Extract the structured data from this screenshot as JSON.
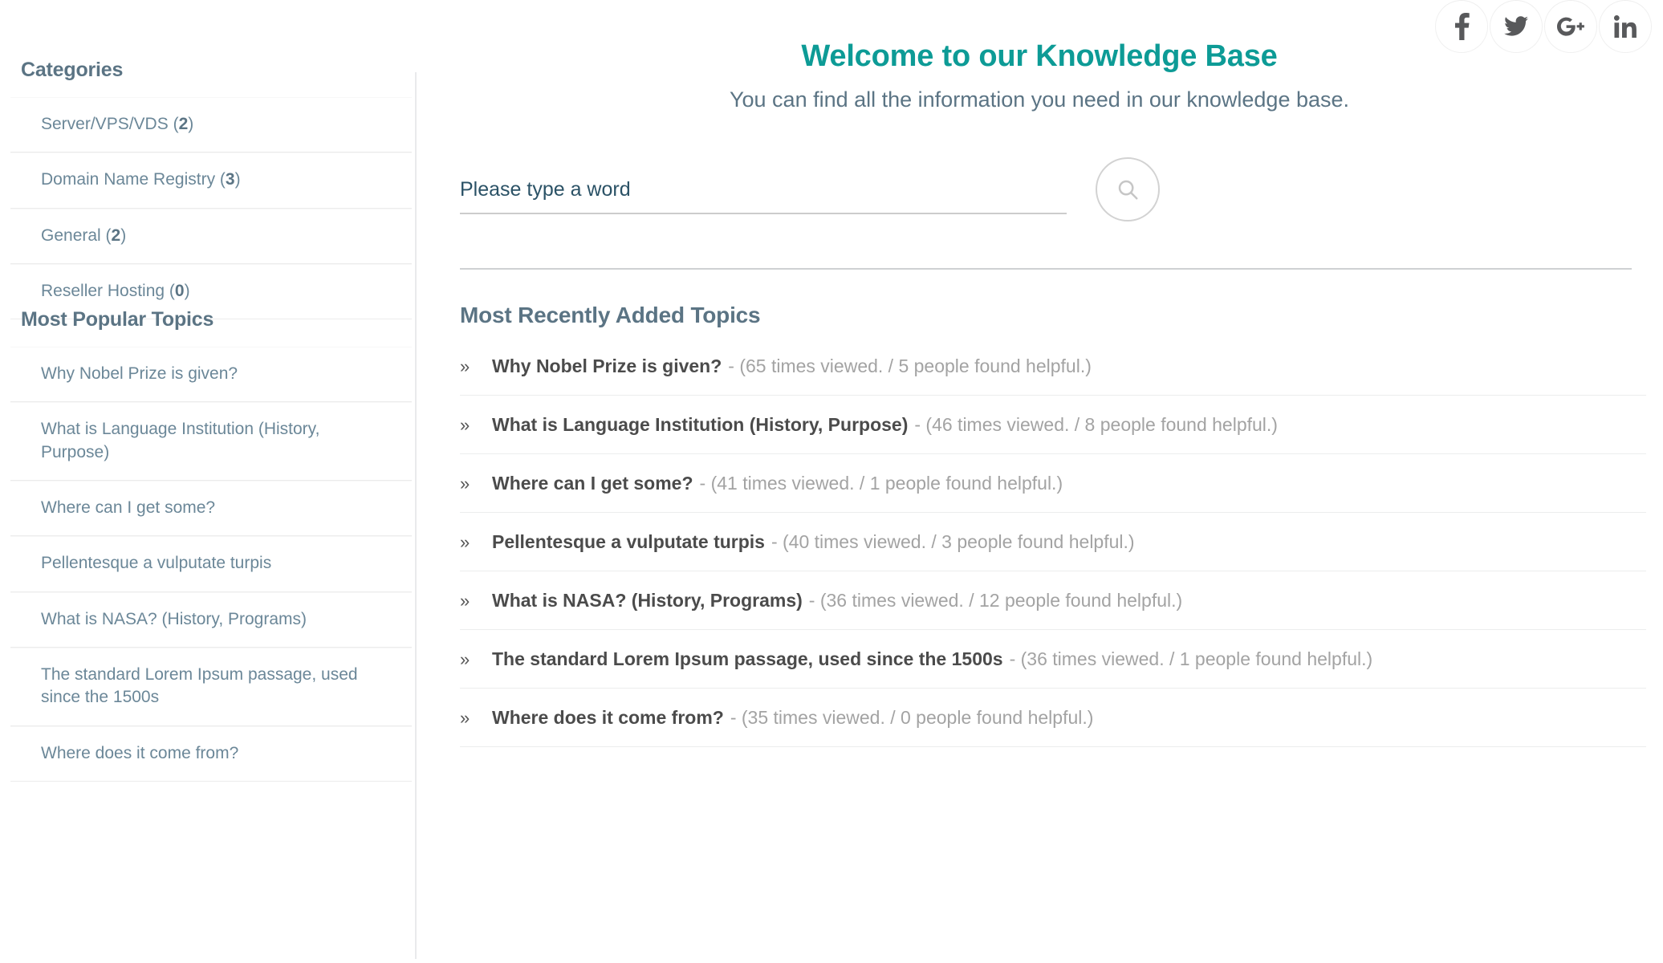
{
  "social": {
    "items": [
      {
        "name": "facebook",
        "label": "f"
      },
      {
        "name": "twitter",
        "label": "t"
      },
      {
        "name": "google-plus",
        "label": "G+"
      },
      {
        "name": "linkedin",
        "label": "in"
      }
    ]
  },
  "sidebar": {
    "categories": {
      "title": "Categories",
      "items": [
        {
          "label": "Server/VPS/VDS",
          "count": "2"
        },
        {
          "label": "Domain Name Registry",
          "count": "3"
        },
        {
          "label": "General",
          "count": "2"
        },
        {
          "label": "Reseller Hosting",
          "count": "0"
        }
      ]
    },
    "popular": {
      "title": "Most Popular Topics",
      "items": [
        {
          "label": "Why Nobel Prize is given?"
        },
        {
          "label": "What is Language Institution (History, Purpose)"
        },
        {
          "label": "Where can I get some?"
        },
        {
          "label": "Pellentesque a vulputate turpis"
        },
        {
          "label": "What is NASA? (History, Programs)"
        },
        {
          "label": "The standard Lorem Ipsum passage, used since the 1500s"
        },
        {
          "label": "Where does it come from?"
        }
      ]
    }
  },
  "hero": {
    "title": "Welcome to our Knowledge Base",
    "subtitle": "You can find all the information you need in our knowledge base."
  },
  "search": {
    "value": "",
    "placeholder": "Please type a word",
    "icon": "search-icon"
  },
  "main": {
    "section_title": "Most Recently Added Topics",
    "chevron": "»",
    "topics": [
      {
        "title": "Why Nobel Prize is given?",
        "meta": "- (65 times viewed. / 5 people found helpful.)"
      },
      {
        "title": "What is Language Institution (History, Purpose)",
        "meta": "- (46 times viewed. / 8 people found helpful.)"
      },
      {
        "title": "Where can I get some?",
        "meta": "- (41 times viewed. / 1 people found helpful.)"
      },
      {
        "title": "Pellentesque a vulputate turpis",
        "meta": "- (40 times viewed. / 3 people found helpful.)"
      },
      {
        "title": "What is NASA? (History, Programs)",
        "meta": "- (36 times viewed. / 12 people found helpful.)"
      },
      {
        "title": "The standard Lorem Ipsum passage, used since the 1500s",
        "meta": "- (36 times viewed. / 1 people found helpful.)"
      },
      {
        "title": "Where does it come from?",
        "meta": "- (35 times viewed. / 0 people found helpful.)"
      }
    ]
  },
  "colors": {
    "accent_teal": "#0d9b96",
    "heading_slate": "#5b7484",
    "link_slate": "#6b8798",
    "topic_title": "#4b4b4b",
    "topic_meta": "#a3a3a3",
    "divider": "#eceded"
  }
}
